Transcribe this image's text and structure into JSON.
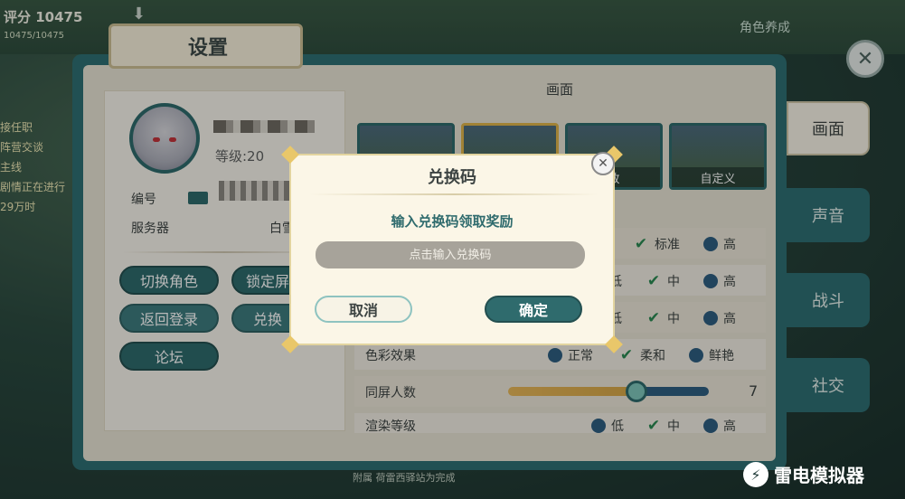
{
  "topbar": {
    "score": "评分 10475",
    "score_sub": "10475/10475",
    "role_label": "角色养成",
    "left_tags": [
      "接任职",
      "阵营交谈",
      "主线",
      "剧情正在进行",
      "29万时"
    ]
  },
  "settings": {
    "title": "设置",
    "profile": {
      "level": "等级:20",
      "id_label": "编号",
      "server_label": "服务器",
      "server_value": "白雪"
    },
    "profile_buttons": [
      {
        "label": "切换角色"
      },
      {
        "label": "锁定屏"
      },
      {
        "label": "返回登录"
      },
      {
        "label": "兑换"
      },
      {
        "label": "论坛"
      }
    ],
    "section_title": "画面",
    "presets": [
      {
        "label": ""
      },
      {
        "label": ""
      },
      {
        "label": "致"
      },
      {
        "label": "自定义"
      }
    ],
    "rows": [
      {
        "label": "",
        "options": [
          {
            "text": "标准",
            "checked": true
          },
          {
            "text": "高",
            "checked": false
          }
        ]
      },
      {
        "label": "",
        "options": [
          {
            "text": "低",
            "checked": false
          },
          {
            "text": "中",
            "checked": true
          },
          {
            "text": "高",
            "checked": false
          }
        ]
      },
      {
        "label": "",
        "options": [
          {
            "text": "低",
            "checked": false
          },
          {
            "text": "中",
            "checked": true
          },
          {
            "text": "高",
            "checked": false
          }
        ]
      },
      {
        "label": "色彩效果",
        "options": [
          {
            "text": "正常",
            "checked": false
          },
          {
            "text": "柔和",
            "checked": true
          },
          {
            "text": "鲜艳",
            "checked": false
          }
        ]
      },
      {
        "label": "同屏人数",
        "slider_value": "7",
        "slider_fraction": 0.62
      },
      {
        "label": "渲染等级",
        "options": [
          {
            "text": "低",
            "checked": false
          },
          {
            "text": "中",
            "checked": true
          },
          {
            "text": "高",
            "checked": false
          }
        ]
      }
    ],
    "side_tabs": [
      {
        "label": "画面",
        "active": true
      },
      {
        "label": "声音",
        "active": false
      },
      {
        "label": "战斗",
        "active": false
      },
      {
        "label": "社交",
        "active": false
      }
    ]
  },
  "dialog": {
    "title": "兑换码",
    "subtitle": "输入兑换码领取奖励",
    "input_placeholder": "点击输入兑换码",
    "cancel_label": "取消",
    "confirm_label": "确定"
  },
  "watermark": "雷电模拟器",
  "bottom_text": "附属 荷雷西驿站为完成"
}
